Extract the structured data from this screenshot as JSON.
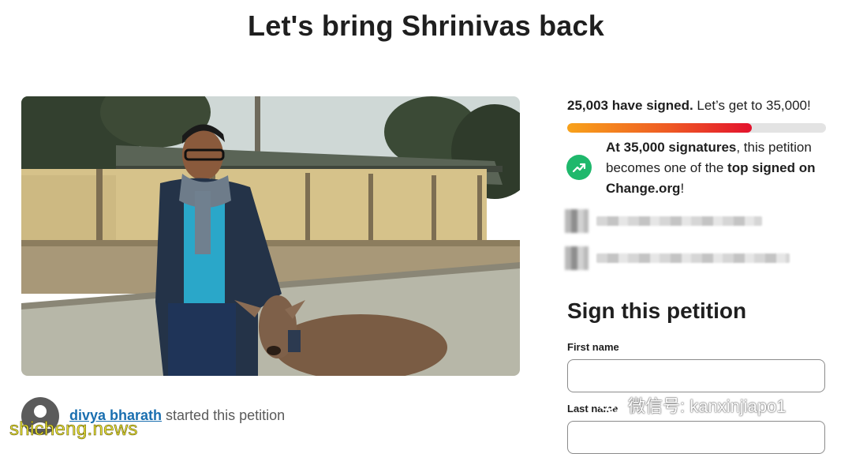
{
  "page": {
    "title": "Let's bring Shrinivas back"
  },
  "petition": {
    "starter_name": "divya bharath",
    "starter_suffix": " started this petition"
  },
  "signatures": {
    "count_text": "25,003 have signed.",
    "goal_text": " Let’s get to 35,000!",
    "progress_fraction": 0.714
  },
  "goal_message": {
    "bold_1": "At 35,000 signatures",
    "text_1": ", this petition becomes one of the ",
    "bold_2": "top signed on Change.org",
    "text_2": "!"
  },
  "sign_form": {
    "heading": "Sign this petition",
    "first_name_label": "First name",
    "last_name_label": "Last name"
  },
  "watermarks": {
    "site": "shicheng.news",
    "wechat": "微信号: kanxinjiapo1"
  },
  "colors": {
    "progress_start": "#f8a21a",
    "progress_end": "#e3122d",
    "trend_icon_bg": "#1fb86c",
    "link": "#1a6fb0"
  },
  "icons": [
    "user-avatar-icon",
    "trending-up-icon",
    "wechat-icon"
  ]
}
